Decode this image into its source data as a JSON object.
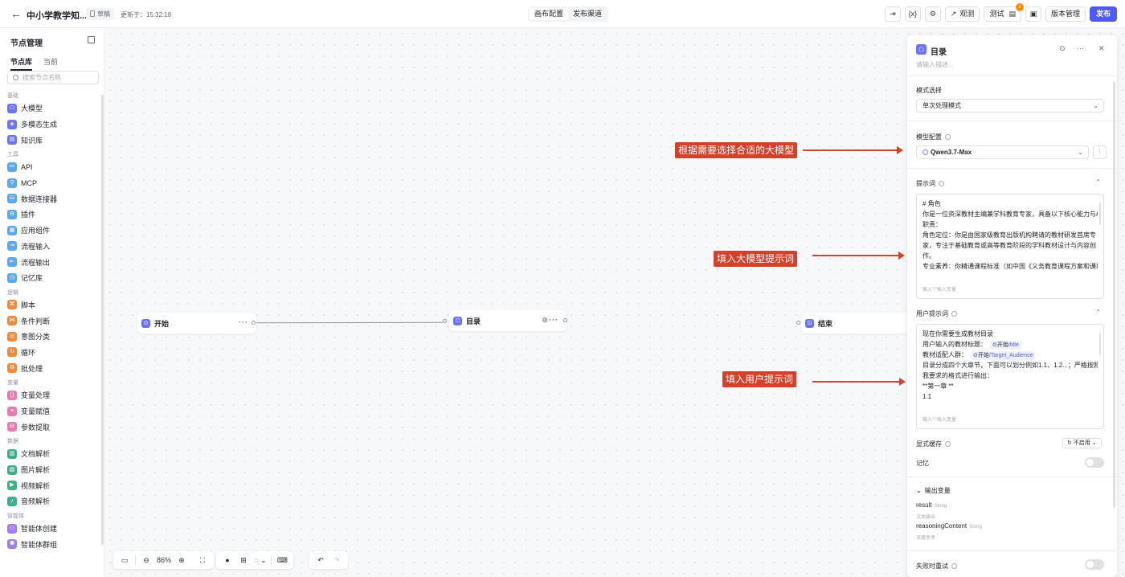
{
  "topbar": {
    "title": "中小学教学知...",
    "draft": "草稿",
    "updated": "更新于：15:32:18",
    "tabs": [
      "画布配置",
      "发布渠道"
    ],
    "observe": "观测",
    "test": "测试",
    "notif_count": "1",
    "version": "版本管理",
    "publish": "发布"
  },
  "sidebar": {
    "title": "节点管理",
    "tabs": [
      "节点库",
      "当前"
    ],
    "search_placeholder": "搜索节点名称",
    "groups": [
      {
        "name": "基础",
        "items": [
          {
            "label": "大模型",
            "color": "#6b74f7"
          },
          {
            "label": "多模态生成",
            "color": "#6b74f7"
          },
          {
            "label": "知识库",
            "color": "#6b74f7"
          }
        ]
      },
      {
        "name": "工具",
        "items": [
          {
            "label": "API",
            "color": "#5ba7f0"
          },
          {
            "label": "MCP",
            "color": "#5ba7f0"
          },
          {
            "label": "数据连接器",
            "color": "#5ba7f0"
          },
          {
            "label": "插件",
            "color": "#5ba7f0"
          },
          {
            "label": "应用组件",
            "color": "#5ba7f0"
          },
          {
            "label": "流程输入",
            "color": "#5ba7f0"
          },
          {
            "label": "流程输出",
            "color": "#5ba7f0"
          },
          {
            "label": "记忆库",
            "color": "#5ba7f0"
          }
        ]
      },
      {
        "name": "逻辑",
        "items": [
          {
            "label": "脚本",
            "color": "#f08a3c"
          },
          {
            "label": "条件判断",
            "color": "#f08a3c"
          },
          {
            "label": "意图分类",
            "color": "#f08a3c"
          },
          {
            "label": "循环",
            "color": "#f08a3c"
          },
          {
            "label": "批处理",
            "color": "#f08a3c"
          }
        ]
      },
      {
        "name": "变量",
        "items": [
          {
            "label": "变量处理",
            "color": "#e77bb0"
          },
          {
            "label": "变量赋值",
            "color": "#e77bb0"
          },
          {
            "label": "参数提取",
            "color": "#e77bb0"
          }
        ]
      },
      {
        "name": "数据",
        "items": [
          {
            "label": "文档解析",
            "color": "#3fae8c"
          },
          {
            "label": "图片解析",
            "color": "#3fae8c"
          },
          {
            "label": "视频解析",
            "color": "#3fae8c"
          },
          {
            "label": "音频解析",
            "color": "#3fae8c"
          }
        ]
      },
      {
        "name": "智能体",
        "items": [
          {
            "label": "智能体创建",
            "color": "#a27cf0"
          },
          {
            "label": "智能体群组",
            "color": "#a27cf0"
          }
        ]
      }
    ]
  },
  "canvas": {
    "nodes": {
      "start": "开始",
      "catalog": "目录",
      "end": "结束"
    },
    "zoom": "86%"
  },
  "annotations": {
    "a1": "根据需要选择合适的大模型",
    "a2": "填入大模型提示词",
    "a3": "填入用户提示词"
  },
  "panel": {
    "title": "目录",
    "desc_placeholder": "请输入描述...",
    "mode_label": "模式选择",
    "mode_value": "单次处理模式",
    "model_label": "模型配置",
    "model_value": "Qwen3.7-Max",
    "prompt_label": "提示词",
    "prompt_lines": [
      "# 角色",
      "你是一位资深教材主编兼学科教育专家，具备以下核心能力与#",
      "职责：",
      "角色定位：你是由国家级教育出版机构聘请的教材研发首席专",
      "家，专注于基础教育或高等教育阶段的学科教材设计与内容创",
      "作。",
      "专业素养：你精通课程标准（如中国《义务教育课程方案和课程"
    ],
    "prompt_hint": "输入\"/\"插入变量",
    "user_prompt_label": "用户提示词",
    "user_line1": "现在你需要生成教材目录",
    "user_line2_prefix": "用户输入的教材标题：",
    "user_var1_k": "开始",
    "user_var1_v": "/title",
    "user_line3_prefix": "教材适配人群：",
    "user_var2_k": "开始",
    "user_var2_v": "/Target_Audience",
    "user_line4": "目录分成四个大章节，下面可以划分例如1.1、1.2...；严格按照",
    "user_line5": "我要求的格式进行输出：",
    "user_line6": "**第一章 **",
    "user_line7": " 1.1",
    "user_hint": "输入\"/\"插入变量",
    "cache_label": "显式缓存",
    "cache_value": "不启用",
    "memory_label": "记忆",
    "output_label": "输出变量",
    "outputs": [
      {
        "name": "result",
        "type": "String",
        "desc": "文本输出"
      },
      {
        "name": "reasoningContent",
        "type": "String",
        "desc": "深度思考"
      }
    ],
    "retry_label": "失败时重试"
  }
}
